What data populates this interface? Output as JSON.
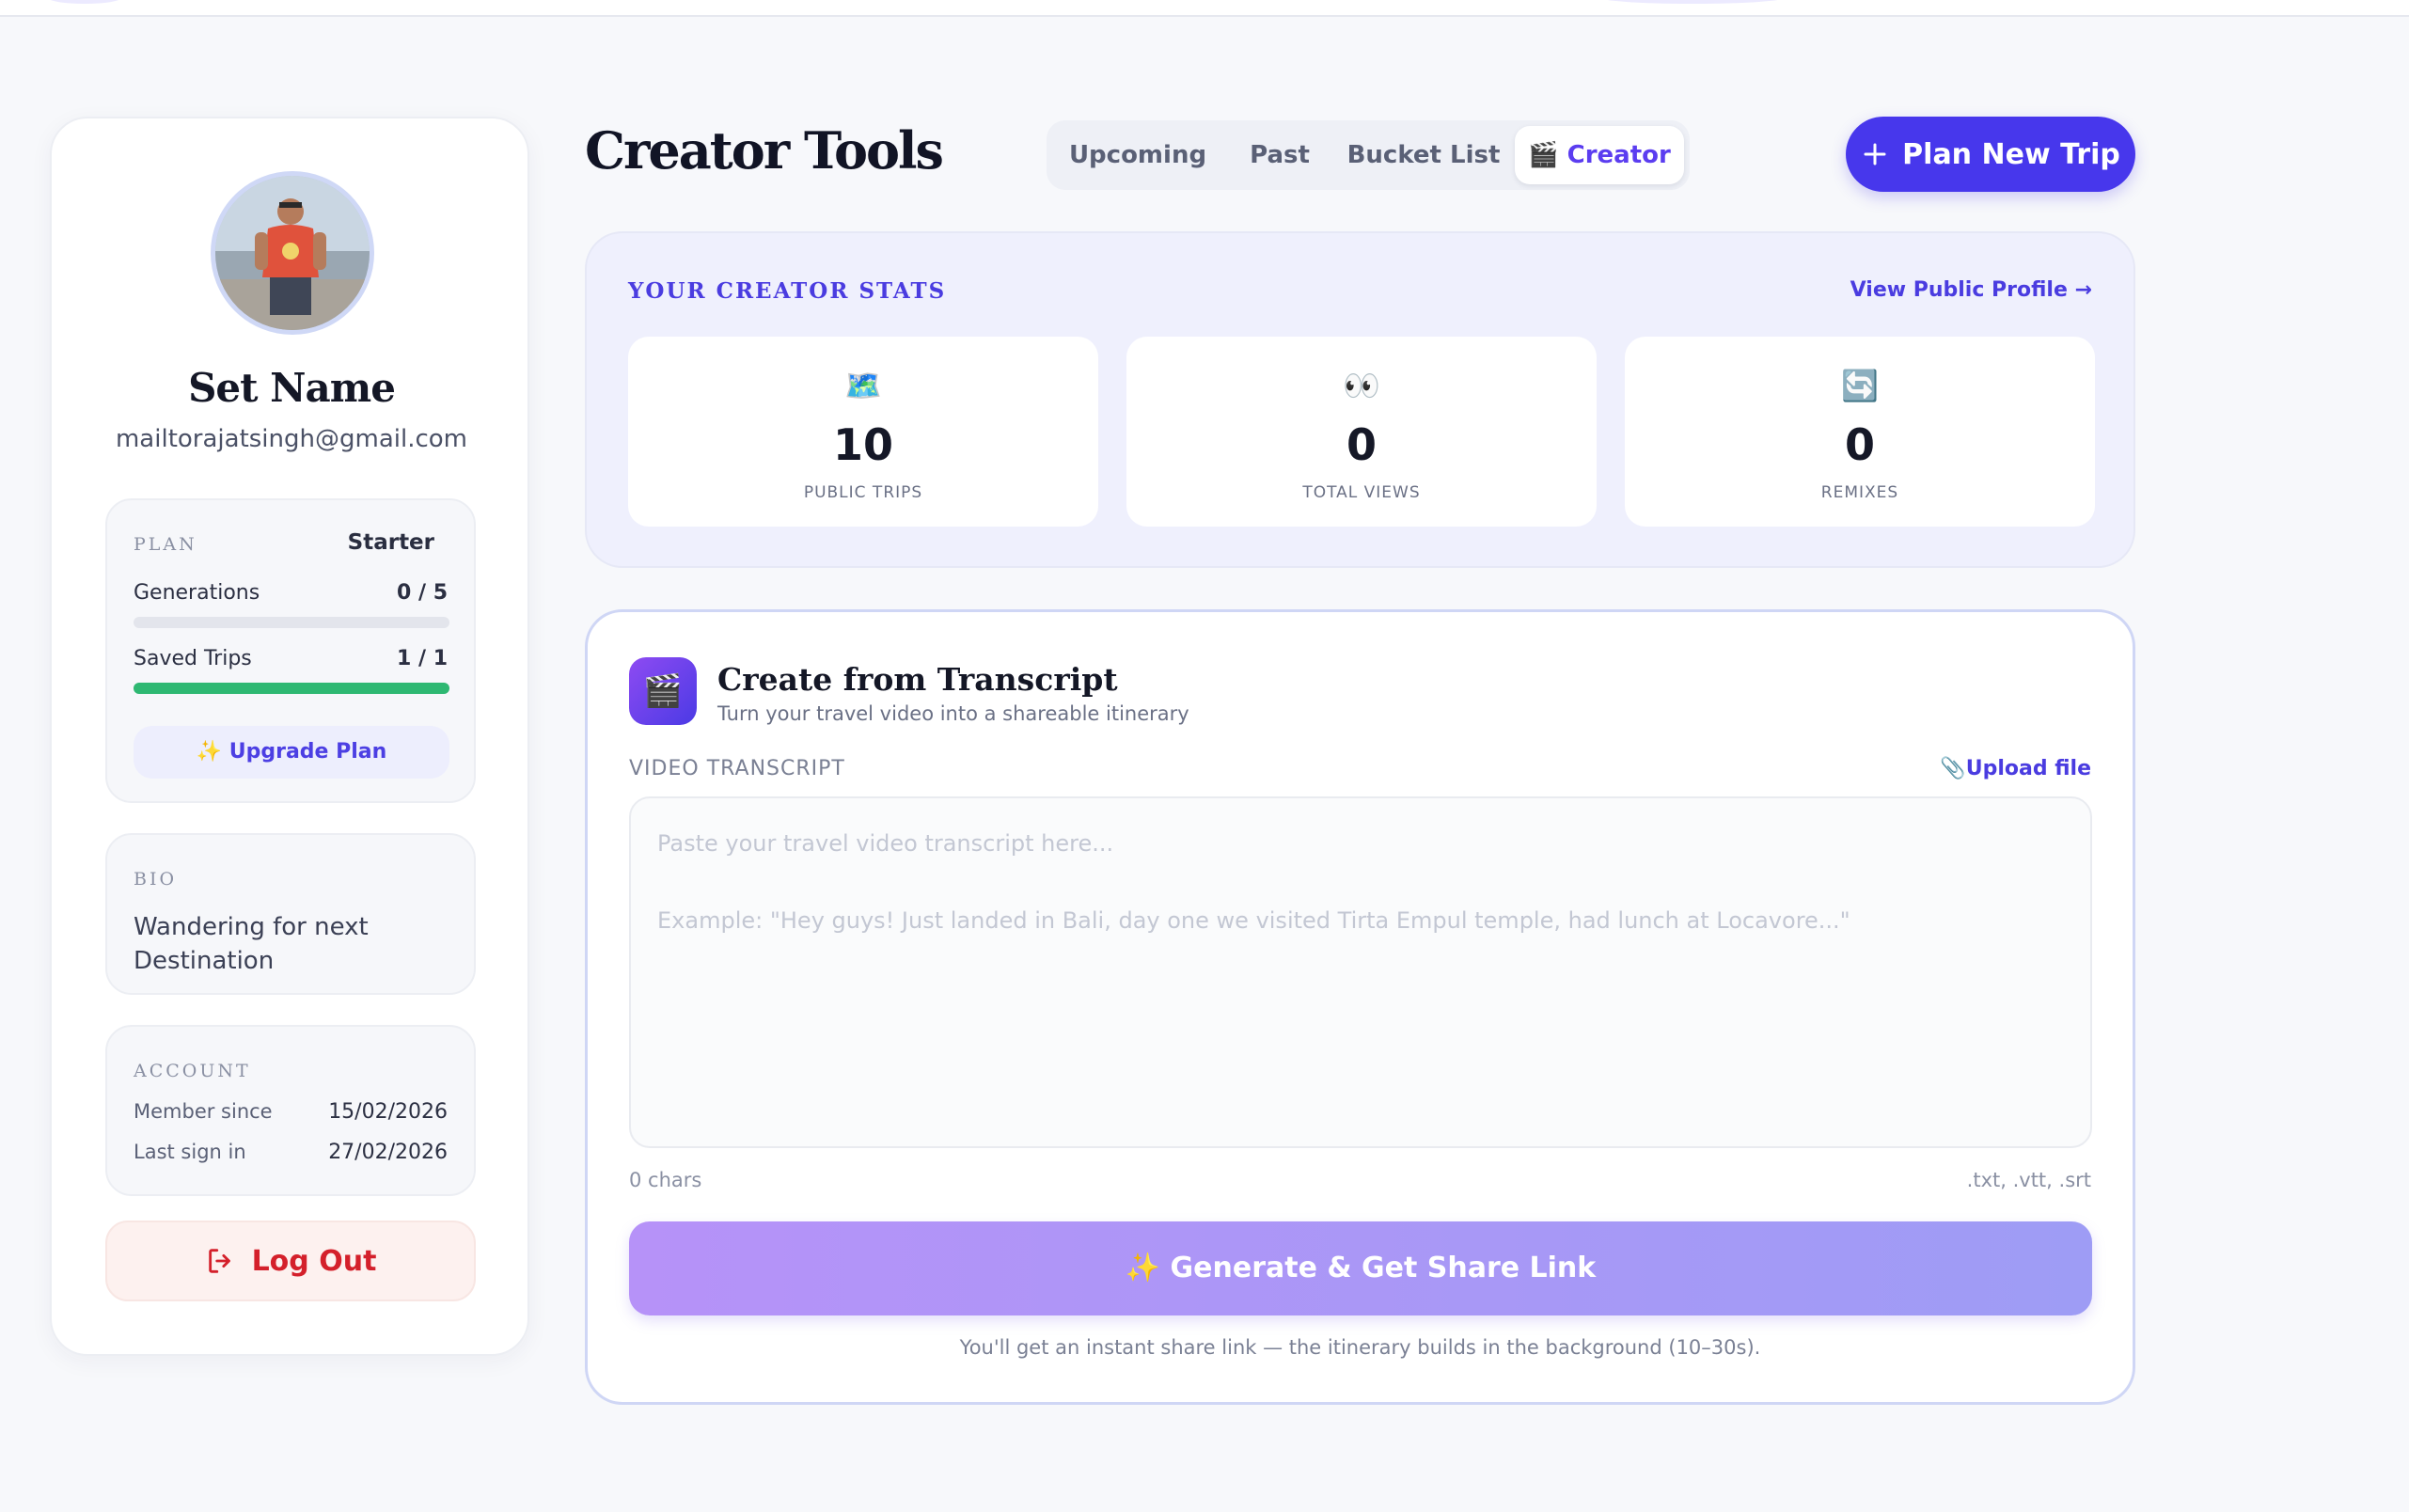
{
  "profile": {
    "name": "Set Name",
    "email": "mailtorajatsingh@gmail.com"
  },
  "plan": {
    "label": "PLAN",
    "tier": "Starter",
    "generations_label": "Generations",
    "generations_value": "0 / 5",
    "generations_progress": 0,
    "saved_trips_label": "Saved Trips",
    "saved_trips_value": "1 / 1",
    "saved_trips_progress": 1,
    "upgrade_label": "✨ Upgrade Plan",
    "progress_color": "#2eb872"
  },
  "bio": {
    "label": "BIO",
    "text": "Wandering for next Destination"
  },
  "account": {
    "label": "ACCOUNT",
    "member_since_label": "Member since",
    "member_since_value": "15/02/2026",
    "last_sign_in_label": "Last sign in",
    "last_sign_in_value": "27/02/2026"
  },
  "logout_label": "Log Out",
  "header": {
    "title": "Creator Tools",
    "tabs": [
      {
        "label": "Upcoming",
        "active": false
      },
      {
        "label": "Past",
        "active": false
      },
      {
        "label": "Bucket List",
        "active": false
      },
      {
        "label": "🎬 Creator",
        "active": true
      }
    ],
    "plan_trip_label": "Plan New Trip"
  },
  "stats": {
    "title": "YOUR CREATOR STATS",
    "view_profile_label": "View Public Profile →",
    "items": [
      {
        "icon": "🗺️",
        "icon_name": "map-icon",
        "value": "10",
        "label": "PUBLIC TRIPS"
      },
      {
        "icon": "👀",
        "icon_name": "eyes-icon",
        "value": "0",
        "label": "TOTAL VIEWS"
      },
      {
        "icon": "🔄",
        "icon_name": "remix-icon",
        "value": "0",
        "label": "REMIXES"
      }
    ]
  },
  "transcript": {
    "icon": "🎬",
    "title": "Create from Transcript",
    "subtitle": "Turn your travel video into a shareable itinerary",
    "field_label": "VIDEO TRANSCRIPT",
    "upload_label": "📎Upload file",
    "placeholder": "Paste your travel video transcript here...\n\nExample: \"Hey guys! Just landed in Bali, day one we visited Tirta Empul temple, had lunch at Locavore...\"",
    "value": "",
    "chars": "0 chars",
    "file_types": ".txt, .vtt, .srt",
    "generate_label": "✨ Generate & Get Share Link",
    "footnote": "You'll get an instant share link — the itinerary builds in the background (10–30s)."
  },
  "colors": {
    "accent": "#4737ec",
    "accent_text": "#4a3ce0",
    "danger": "#d4202b",
    "success": "#2eb872"
  }
}
